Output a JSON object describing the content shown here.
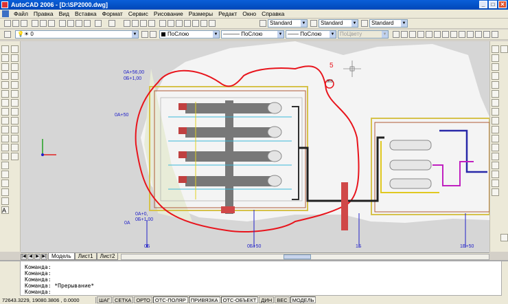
{
  "window": {
    "title": "AutoCAD 2006 - [D:\\SP2000.dwg]",
    "buttons": [
      "_",
      "□",
      "✕"
    ]
  },
  "menu": [
    "Файл",
    "Правка",
    "Вид",
    "Вставка",
    "Формат",
    "Сервис",
    "Рисование",
    "Размеры",
    "Редакт",
    "Окно",
    "Справка"
  ],
  "styles_toolbar": {
    "text_style": "Standard",
    "dim_style": "Standard",
    "table_style": "Standard"
  },
  "layers_toolbar": {
    "layer": "0",
    "color": "ПоСлою",
    "linetype": "ПоСлою",
    "lineweight": "ПоСлою",
    "plotstyle": "ПоЦвету"
  },
  "drawing_labels": {
    "top_left_1": "0А+56,00",
    "top_left_2": "0Б+1,00",
    "left_mid": "0А+50",
    "bottom_left_1": "0А+0,",
    "bottom_left_2": "0Б+1,00",
    "bottom_left_3": "0А",
    "bottom_axis": [
      "0Б",
      "0Б+50",
      "1Б",
      "1Б+50"
    ],
    "marker": "5",
    "marker_sub": "Ж0"
  },
  "tabs": {
    "items": [
      "Модель",
      "Лист1",
      "Лист2"
    ],
    "active": "Модель"
  },
  "command": {
    "lines": [
      "Команда:",
      "Команда:",
      "Команда:",
      "Команда: *Прерывание*",
      "Команда:"
    ]
  },
  "status": {
    "coords": "72643.3229, 19080.3806 , 0.0000",
    "buttons": [
      "ШАГ",
      "СЕТКА",
      "ОРТО",
      "ОТС-ПОЛЯР",
      "ПРИВЯЗКА",
      "ОТС-ОБЪЕКТ",
      "ДИН",
      "ВЕС",
      "МОДЕЛЬ"
    ],
    "on_buttons": [
      "ОТС-ПОЛЯР",
      "ПРИВЯЗКА",
      "ОТС-ОБЪЕКТ",
      "МОДЕЛЬ"
    ]
  },
  "colors": {
    "title_bar": "#0a5fd8",
    "drawing_bg": "#d6d6d6",
    "highlight_red": "#e8141c",
    "axis_blue": "#2020c8"
  }
}
